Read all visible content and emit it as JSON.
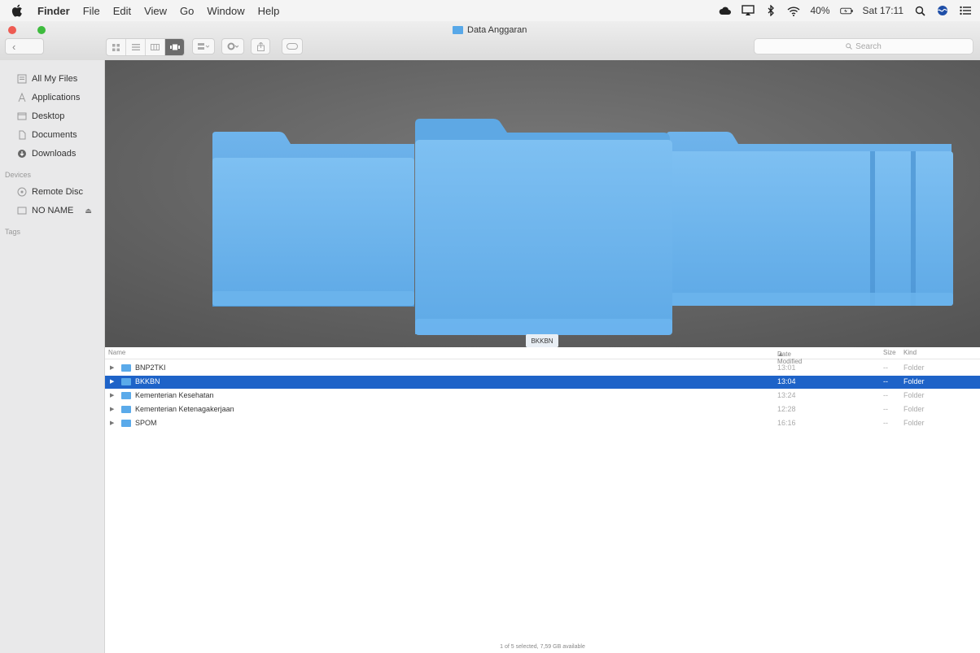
{
  "menubar": {
    "app_name": "Finder",
    "menus": [
      "File",
      "Edit",
      "View",
      "Go",
      "Window",
      "Help"
    ],
    "battery": "40%",
    "clock": "Sat 17:11"
  },
  "window": {
    "title": "Data Anggaran",
    "search_placeholder": "Search"
  },
  "sidebar": {
    "favorites": [
      {
        "label": "All My Files",
        "icon": "all-files-icon"
      },
      {
        "label": "Applications",
        "icon": "applications-icon"
      },
      {
        "label": "Desktop",
        "icon": "desktop-icon"
      },
      {
        "label": "Documents",
        "icon": "documents-icon"
      },
      {
        "label": "Downloads",
        "icon": "downloads-icon"
      }
    ],
    "devices_header": "Devices",
    "devices": [
      {
        "label": "Remote Disc",
        "icon": "remote-disc-icon"
      },
      {
        "label": "NO NAME",
        "icon": "drive-icon"
      }
    ],
    "tags_header": "Tags"
  },
  "coverflow": {
    "selected_label": "BKKBN"
  },
  "list": {
    "headers": {
      "name": "Name",
      "date": "Date Modified",
      "size": "Size",
      "kind": "Kind"
    },
    "rows": [
      {
        "name": "BNP2TKI",
        "date": "13:01",
        "size": "--",
        "kind": "Folder",
        "selected": false
      },
      {
        "name": "BKKBN",
        "date": "13:04",
        "size": "--",
        "kind": "Folder",
        "selected": true
      },
      {
        "name": "Kementerian Kesehatan",
        "date": "13:24",
        "size": "--",
        "kind": "Folder",
        "selected": false
      },
      {
        "name": "Kementerian Ketenagakerjaan",
        "date": "12:28",
        "size": "--",
        "kind": "Folder",
        "selected": false
      },
      {
        "name": "SPOM",
        "date": "16:16",
        "size": "--",
        "kind": "Folder",
        "selected": false
      }
    ]
  },
  "status": "1 of 5 selected, 7,59 GB available",
  "colors": {
    "selection": "#1e63c8",
    "folder": "#5aaaea"
  }
}
